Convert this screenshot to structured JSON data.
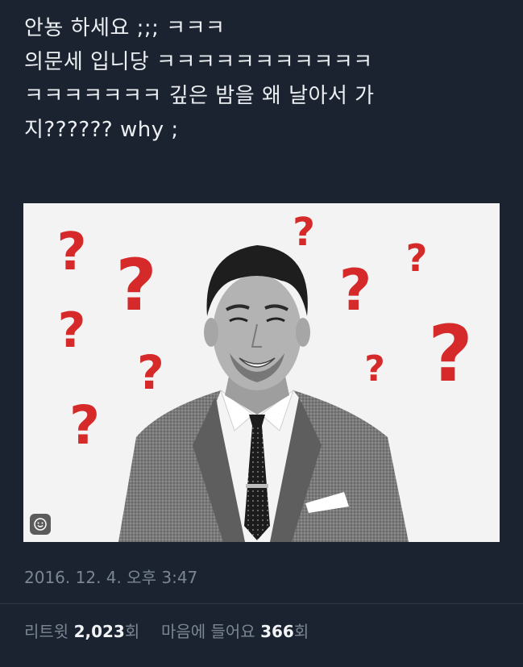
{
  "tweet": {
    "lines": [
      "안뇽 하세요 ;;; ㅋㅋㅋ",
      "의문세 입니당 ㅋㅋㅋㅋㅋㅋㅋㅋㅋㅋㅋ",
      "ㅋㅋㅋㅋㅋㅋㅋ 깊은 밤을 왜 날아서 가",
      "지?????? why ;"
    ],
    "timestamp": "2016. 12. 4. 오후 3:47"
  },
  "media": {
    "question_mark": "?",
    "question_color": "#d62a2a",
    "sticker_icon": "smiley-icon"
  },
  "stats": {
    "retweet_label": "리트윗",
    "retweet_count": "2,023",
    "retweet_unit": "회",
    "likes_label": "마음에 들어요",
    "likes_count": "366",
    "likes_unit": "회"
  }
}
